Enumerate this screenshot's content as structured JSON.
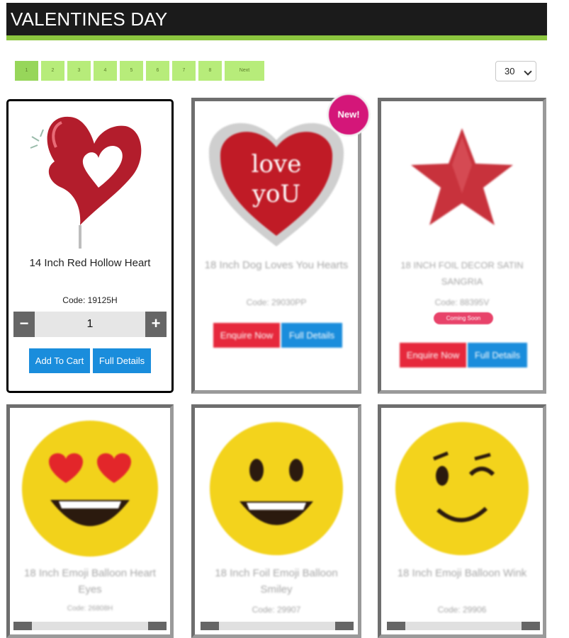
{
  "page": {
    "title": "VALENTINES DAY"
  },
  "pagination": {
    "pages": [
      "1",
      "2",
      "3",
      "4",
      "5",
      "6",
      "7",
      "8"
    ],
    "next_label": "Next",
    "active_page": "1"
  },
  "per_page": {
    "value": "30"
  },
  "products": [
    {
      "title": "14 Inch Red Hollow Heart",
      "code": "Code: 19125H",
      "quantity": "1",
      "add_label": "Add To Cart",
      "details_label": "Full Details"
    },
    {
      "title": "18 Inch Dog Loves You Hearts",
      "code": "Code: 29030PP",
      "badge": "New!",
      "enquire_label": "Enquire Now",
      "details_label": "Full Details"
    },
    {
      "title": "18 INCH FOIL DECOR SATIN SANGRIA",
      "code": "Code: 88395V",
      "pill": "Coming Soon",
      "enquire_label": "Enquire Now",
      "details_label": "Full Details"
    },
    {
      "title": "18 Inch Emoji Balloon Heart Eyes",
      "code": "Code: 26808H"
    },
    {
      "title": "18 Inch Foil Emoji Balloon Smiley",
      "code": "Code: 29907"
    },
    {
      "title": "18 Inch Emoji Balloon Wink",
      "code": "Code: 29906"
    }
  ],
  "colors": {
    "accent": "#8cc63f",
    "blue_button": "#1a8ddc",
    "red_button": "#e6283c",
    "badge": "#d41679"
  }
}
